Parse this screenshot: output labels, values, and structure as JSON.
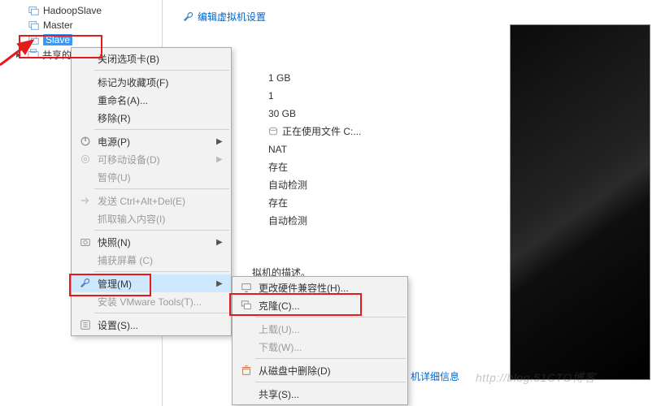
{
  "tree": {
    "items": [
      {
        "label": "HadoopSlave"
      },
      {
        "label": "Master"
      },
      {
        "label": "Slave"
      },
      {
        "shared_label_partial": "共享的"
      }
    ]
  },
  "toolbar": {
    "edit_settings": "编辑虚拟机设置"
  },
  "props": {
    "memory": "1 GB",
    "cpus": "1",
    "disk": "30 GB",
    "disk_status": "正在使用文件 C:...",
    "network": "NAT",
    "exist1": "存在",
    "autodetect1": "自动检测",
    "exist2": "存在",
    "autodetect2": "自动检测"
  },
  "description_label": "拟机的描述。",
  "more_link": "机详细信息",
  "watermark": "http://blog.51CTO博客",
  "menu1": {
    "close_tab": "关闭选项卡(B)",
    "mark_fav": "标记为收藏项(F)",
    "rename": "重命名(A)...",
    "remove": "移除(R)",
    "power": "电源(P)",
    "removable": "可移动设备(D)",
    "pause": "暂停(U)",
    "send_cad": "发送 Ctrl+Alt+Del(E)",
    "grab_input": "抓取输入内容(I)",
    "snapshot": "快照(N)",
    "capture": "捕获屏幕 (C)",
    "manage": "管理(M)",
    "install_tools": "安装 VMware Tools(T)...",
    "settings": "设置(S)..."
  },
  "menu2": {
    "change_hw": "更改硬件兼容性(H)...",
    "clone": "克隆(C)...",
    "upload": "上载(U)...",
    "download": "下载(W)...",
    "delete_disk": "从磁盘中删除(D)",
    "share": "共享(S)..."
  }
}
